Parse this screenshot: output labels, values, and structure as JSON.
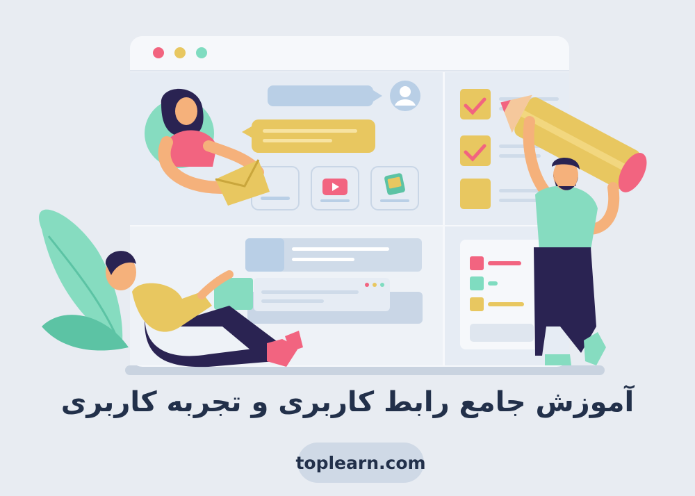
{
  "title": "آموزش جامع رابط کاربری و تجربه کاربری",
  "site": "toplearn.com",
  "colors": {
    "background": "#e8ecf2",
    "window": "#f6f8fb",
    "accent_yellow": "#e8c760",
    "accent_teal": "#7fdcc0",
    "accent_pink": "#f26480",
    "navy": "#22304a"
  },
  "window": {
    "traffic_lights": [
      "red-dot",
      "yellow-dot",
      "green-dot"
    ]
  },
  "checklist": {
    "items": [
      {
        "checked": true
      },
      {
        "checked": true
      },
      {
        "checked": false
      }
    ]
  }
}
